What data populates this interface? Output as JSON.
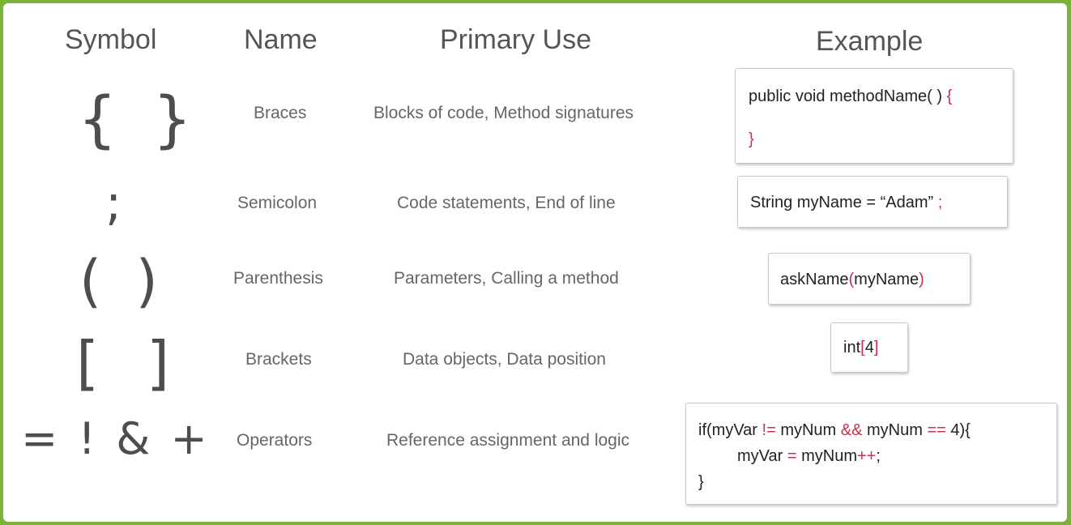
{
  "headers": {
    "symbol": "Symbol",
    "name": "Name",
    "use": "Primary Use",
    "example": "Example"
  },
  "colors": {
    "frame": "#7bb23a",
    "highlight": "#c8314f",
    "text": "#666666"
  },
  "rows": [
    {
      "symbol": "{ }",
      "name": "Braces",
      "use": "Blocks of code, Method signatures",
      "example": {
        "l1a": "public void methodName( ) ",
        "l1b": "{",
        "l2": "}"
      }
    },
    {
      "symbol": ";",
      "name": "Semicolon",
      "use": "Code statements, End of line",
      "example": {
        "a": "String myName  =  “Adam” ",
        "b": ";"
      }
    },
    {
      "symbol": "( )",
      "name": "Parenthesis",
      "use": "Parameters, Calling a method",
      "example": {
        "a": "askName",
        "b": "(",
        "c": "myName",
        "d": ")"
      }
    },
    {
      "symbol": "[ ]",
      "name": "Brackets",
      "use": "Data objects, Data position",
      "example": {
        "a": "int",
        "b": "[",
        "c": "4",
        "d": "]"
      }
    },
    {
      "symbol": "= ! & +",
      "name": "Operators",
      "use": "Reference assignment and logic",
      "example": {
        "l1a": "if(myVar ",
        "l1b": "!=",
        "l1c": " myNum ",
        "l1d": "&&",
        "l1e": " myNum ",
        "l1f": "==",
        "l1g": " 4){",
        "l2a": "myVar ",
        "l2b": "=",
        "l2c": " myNum",
        "l2d": "++",
        "l2e": ";",
        "l3": "}"
      }
    }
  ]
}
